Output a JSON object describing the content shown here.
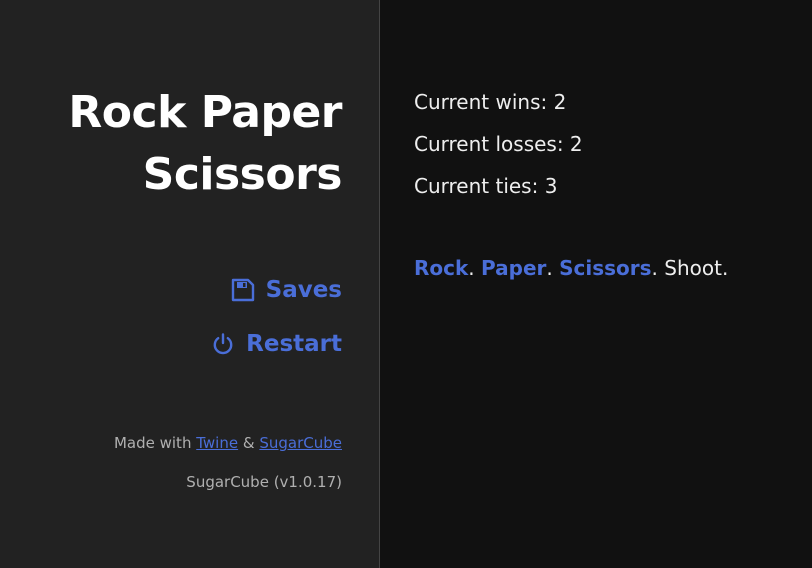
{
  "sidebar": {
    "title_line1": "Rock Paper",
    "title_line2": "Scissors",
    "menu": {
      "saves_label": "Saves",
      "saves_icon": "floppy-disk-icon",
      "restart_label": "Restart",
      "restart_icon": "power-icon"
    },
    "credits": {
      "made_with": "Made with",
      "twine": "Twine",
      "amp": "&",
      "sugarcube": "SugarCube",
      "version": "SugarCube (v1.0.17)"
    }
  },
  "passage": {
    "stats": [
      {
        "label": "Current wins: 2"
      },
      {
        "label": "Current losses: 2"
      },
      {
        "label": "Current ties: 3"
      }
    ],
    "choices": {
      "rock": "Rock",
      "dot1": ". ",
      "paper": "Paper",
      "dot2": ". ",
      "scissors": "Scissors",
      "tail": ". Shoot."
    }
  },
  "colors": {
    "sidebar_bg": "#222222",
    "main_bg": "#111111",
    "link": "#4a6ed8",
    "text": "#eeeeee",
    "muted": "#b0b0b0"
  }
}
